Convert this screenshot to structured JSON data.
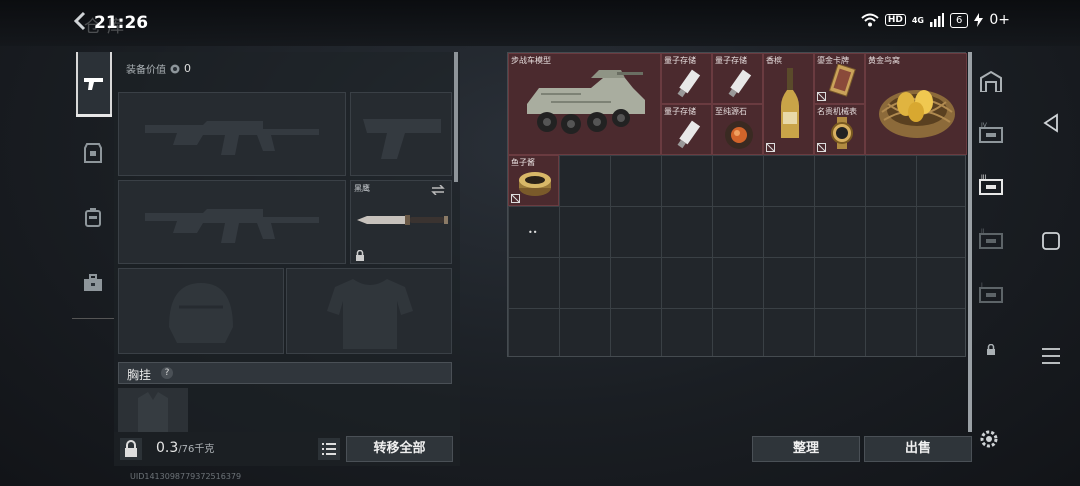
{
  "status_bar": {
    "time": "21:26",
    "ghost_title": "仓库",
    "ghost_number": "0",
    "signal": "4G",
    "battery": "6",
    "network_speed": "0+"
  },
  "equipment": {
    "value_label": "装备价值",
    "value": "0",
    "melee_label": "黑鹰",
    "chest_rig_label": "胸挂",
    "help_symbol": "?",
    "weight_current": "0.3",
    "weight_max": "/76千克",
    "transfer_all_label": "转移全部"
  },
  "inventory": {
    "items": [
      {
        "name": "步战车模型"
      },
      {
        "name": "量子存储"
      },
      {
        "name": "量子存储"
      },
      {
        "name": "香槟"
      },
      {
        "name": "鎏金卡牌"
      },
      {
        "name": "黄金鸟窝"
      },
      {
        "name": "量子存储"
      },
      {
        "name": "至纯源石"
      },
      {
        "name": "名贵机械表"
      },
      {
        "name": "鱼子酱"
      }
    ],
    "small_count": "••"
  },
  "buttons": {
    "sort": "整理",
    "sell": "出售"
  },
  "footer": {
    "uid_text": "UID14130987793725163​79"
  },
  "colors": {
    "item_bg": "#4b2a2e",
    "grid_bg": "#22262b",
    "accent": "#e8e8e8"
  }
}
